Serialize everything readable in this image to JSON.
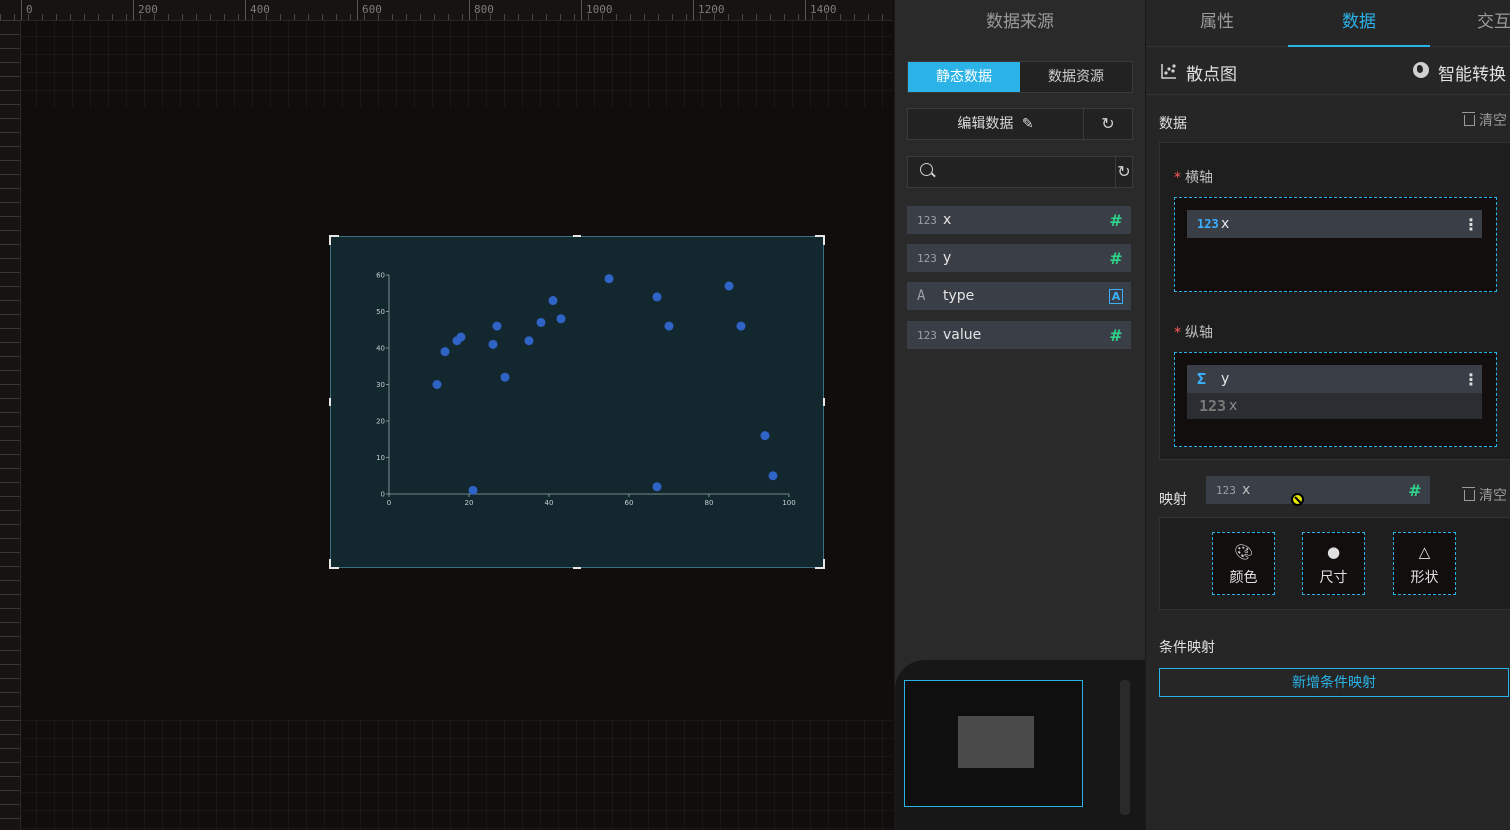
{
  "ruler": {
    "labels": [
      "0",
      "200",
      "400",
      "600",
      "800",
      "1000",
      "1200",
      "1400"
    ]
  },
  "chart_data": {
    "type": "scatter",
    "x_ticks": [
      "0",
      "20",
      "40",
      "60",
      "80",
      "100"
    ],
    "y_ticks": [
      "0",
      "10",
      "20",
      "30",
      "40",
      "50",
      "60"
    ],
    "xlim": [
      0,
      100
    ],
    "ylim": [
      0,
      60
    ],
    "point_color": "#2f63c6",
    "points": [
      {
        "x": 12,
        "y": 30
      },
      {
        "x": 14,
        "y": 39
      },
      {
        "x": 17,
        "y": 42
      },
      {
        "x": 18,
        "y": 43
      },
      {
        "x": 21,
        "y": 1
      },
      {
        "x": 26,
        "y": 41
      },
      {
        "x": 27,
        "y": 46
      },
      {
        "x": 29,
        "y": 32
      },
      {
        "x": 35,
        "y": 42
      },
      {
        "x": 38,
        "y": 47
      },
      {
        "x": 41,
        "y": 53
      },
      {
        "x": 43,
        "y": 48
      },
      {
        "x": 55,
        "y": 59
      },
      {
        "x": 67,
        "y": 54
      },
      {
        "x": 67,
        "y": 2
      },
      {
        "x": 70,
        "y": 46
      },
      {
        "x": 85,
        "y": 57
      },
      {
        "x": 88,
        "y": 46
      },
      {
        "x": 94,
        "y": 16
      },
      {
        "x": 96,
        "y": 5
      }
    ]
  },
  "data_source": {
    "title": "数据来源",
    "tabs": [
      "静态数据",
      "数据资源"
    ],
    "edit_label": "编辑数据",
    "search_placeholder": "",
    "fields": [
      {
        "type": "123",
        "name": "x",
        "badge": "#"
      },
      {
        "type": "123",
        "name": "y",
        "badge": "#"
      },
      {
        "type": "A",
        "name": "type",
        "badge": "A"
      },
      {
        "type": "123",
        "name": "value",
        "badge": "#"
      }
    ]
  },
  "config": {
    "tabs": [
      "属性",
      "数据",
      "交互"
    ],
    "chart_type": "散点图",
    "smart_convert": "智能转换",
    "data_label": "数据",
    "clear_label": "清空",
    "x_axis": {
      "label": "横轴",
      "pill_type": "123",
      "pill_name": "x"
    },
    "y_axis": {
      "label": "纵轴",
      "pill_type": "Σ",
      "pill_name": "y",
      "ghost_type": "123",
      "ghost_name": "x"
    },
    "mapping_label": "映射",
    "mapping_field": {
      "type": "123",
      "name": "x",
      "badge": "#"
    },
    "mapping_clear": "清空",
    "mapping_buttons": [
      "颜色",
      "尺寸",
      "形状"
    ],
    "condition_label": "条件映射",
    "add_condition": "新增条件映射",
    "accent_color": "#2bb3e8"
  }
}
